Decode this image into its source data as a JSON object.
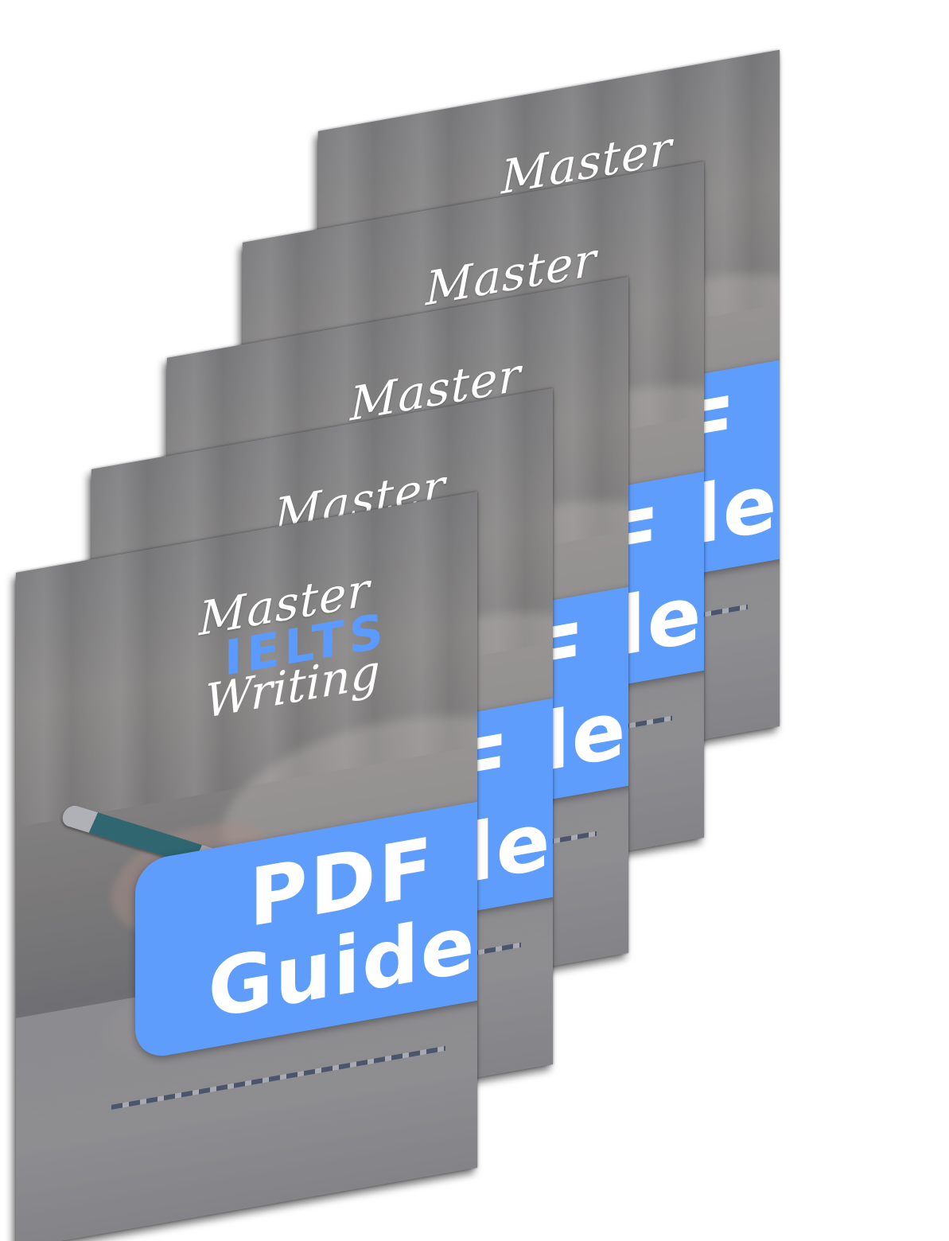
{
  "cover": {
    "title_line1": "Master",
    "title_line2": "IELTS",
    "title_line3": "Writing",
    "badge_line1": "PDF",
    "badge_line2": "Guide"
  },
  "colors": {
    "accent": "#5e9dfb",
    "ielts_text": "#5b9bff",
    "cover_tint": "#75767a",
    "background": "#ffffff"
  }
}
